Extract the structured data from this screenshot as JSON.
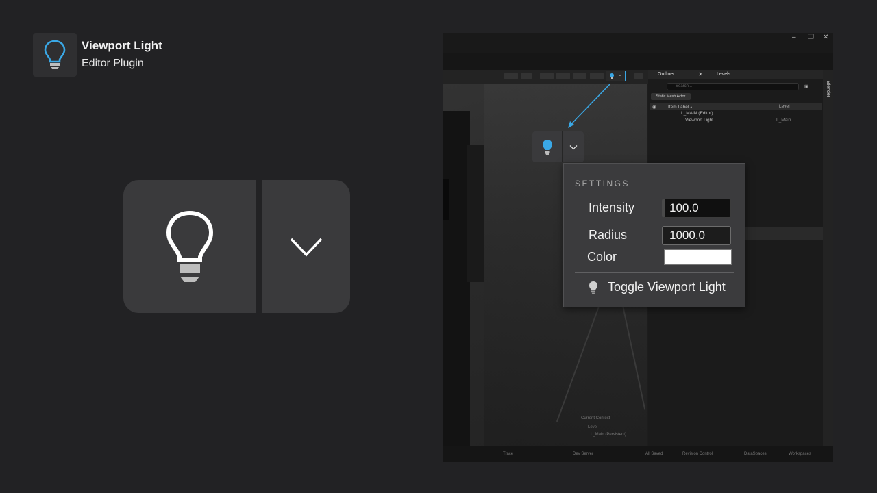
{
  "plugin": {
    "title": "Viewport Light",
    "subtitle": "Editor Plugin",
    "icon": "lightbulb-icon",
    "accent": "#3aa8e6"
  },
  "big_button": {
    "main_icon": "lightbulb-icon",
    "dropdown_icon": "chevron-down-icon"
  },
  "editor": {
    "window_controls": [
      "–",
      "❐",
      "✕"
    ],
    "tabs": [
      "Outliner",
      "Levels"
    ],
    "strip_label": "Blender",
    "search_placeholder": "Search...",
    "filter_chip": "Static Mesh Actor",
    "columns": [
      "Item Label ▴",
      "Level"
    ],
    "tree": [
      {
        "label": "L_MAIN (Editor)",
        "level": ""
      },
      {
        "label": "Viewport Light",
        "level": "L_Main"
      }
    ],
    "current_context": {
      "title": "Current Context",
      "level_label": "Level",
      "level_value": "L_Main (Persistent)"
    },
    "status_items": [
      "Trace",
      "Dev Server",
      "All Saved",
      "Revision Control",
      "DataSpaces",
      "Workspaces"
    ]
  },
  "popup": {
    "header": "SETTINGS",
    "intensity_label": "Intensity",
    "intensity_value": "100.0",
    "radius_label": "Radius",
    "radius_value": "1000.0",
    "color_label": "Color",
    "color_value": "#ffffff",
    "toggle_label": "Toggle Viewport Light",
    "toggle_icon": "lightbulb-icon"
  }
}
